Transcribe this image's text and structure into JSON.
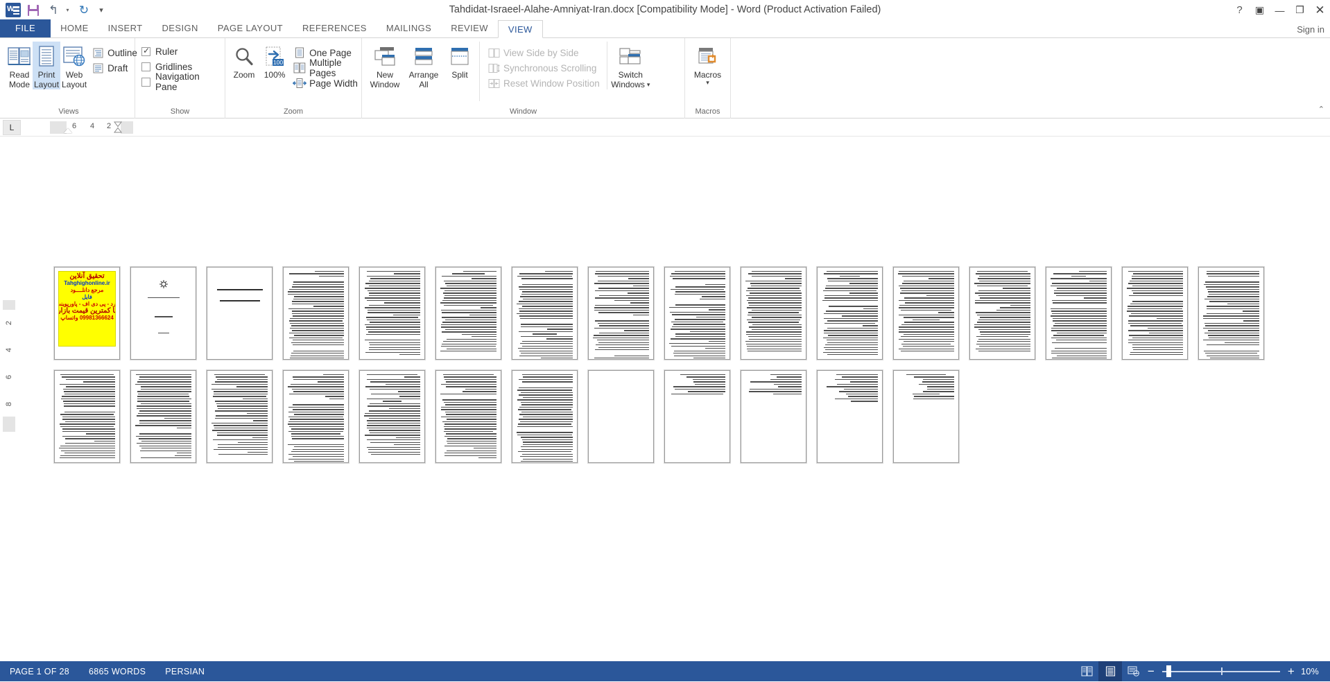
{
  "titlebar": {
    "document_title": "Tahdidat-Israeel-Alahe-Amniyat-Iran.docx [Compatibility Mode] - Word (Product Activation Failed)",
    "quick_access": [
      {
        "name": "word-logo-icon",
        "label": "W"
      },
      {
        "name": "save-icon",
        "label": ""
      },
      {
        "name": "undo-icon",
        "label": "↰"
      },
      {
        "name": "redo-icon",
        "label": "↻"
      },
      {
        "name": "customize-qat-icon",
        "label": "▾"
      }
    ],
    "window_controls": {
      "help": "?",
      "ribbon_display": "▣",
      "minimize": "—",
      "restore": "❐",
      "close": "✕"
    }
  },
  "tabs": {
    "items": [
      {
        "label": "FILE",
        "active": false,
        "file": true
      },
      {
        "label": "HOME",
        "active": false
      },
      {
        "label": "INSERT",
        "active": false
      },
      {
        "label": "DESIGN",
        "active": false
      },
      {
        "label": "PAGE LAYOUT",
        "active": false
      },
      {
        "label": "REFERENCES",
        "active": false
      },
      {
        "label": "MAILINGS",
        "active": false
      },
      {
        "label": "REVIEW",
        "active": false
      },
      {
        "label": "VIEW",
        "active": true
      }
    ],
    "sign_in": "Sign in"
  },
  "ribbon": {
    "groups": [
      {
        "name": "views",
        "label": "Views",
        "big_buttons": [
          {
            "label_line1": "Read",
            "label_line2": "Mode",
            "selected": false,
            "icon": "read-mode-icon"
          },
          {
            "label_line1": "Print",
            "label_line2": "Layout",
            "selected": true,
            "icon": "print-layout-icon"
          },
          {
            "label_line1": "Web",
            "label_line2": "Layout",
            "selected": false,
            "icon": "web-layout-icon"
          }
        ],
        "small_buttons": [
          {
            "label": "Outline",
            "icon": "outline-icon"
          },
          {
            "label": "Draft",
            "icon": "draft-icon"
          }
        ]
      },
      {
        "name": "show",
        "label": "Show",
        "checkboxes": [
          {
            "label": "Ruler",
            "checked": true
          },
          {
            "label": "Gridlines",
            "checked": false
          },
          {
            "label": "Navigation Pane",
            "checked": false
          }
        ]
      },
      {
        "name": "zoom",
        "label": "Zoom",
        "big_buttons": [
          {
            "label_line1": "Zoom",
            "label_line2": "",
            "icon": "magnifier-icon"
          },
          {
            "label_line1": "100%",
            "label_line2": "",
            "icon": "zoom-100-icon"
          }
        ],
        "small_buttons": [
          {
            "label": "One Page",
            "icon": "one-page-icon"
          },
          {
            "label": "Multiple Pages",
            "icon": "multiple-pages-icon"
          },
          {
            "label": "Page Width",
            "icon": "page-width-icon"
          }
        ]
      },
      {
        "name": "window",
        "label": "Window",
        "big_buttons": [
          {
            "label_line1": "New",
            "label_line2": "Window",
            "icon": "new-window-icon"
          },
          {
            "label_line1": "Arrange",
            "label_line2": "All",
            "icon": "arrange-all-icon"
          },
          {
            "label_line1": "Split",
            "label_line2": "",
            "icon": "split-icon"
          }
        ],
        "small_buttons": [
          {
            "label": "View Side by Side",
            "icon": "view-side-by-side-icon",
            "disabled": true
          },
          {
            "label": "Synchronous Scrolling",
            "icon": "synchronous-scrolling-icon",
            "disabled": true
          },
          {
            "label": "Reset Window Position",
            "icon": "reset-window-position-icon",
            "disabled": true
          }
        ],
        "switch_windows": {
          "label_line1": "Switch",
          "label_line2": "Windows",
          "icon": "switch-windows-icon",
          "caret": "▾"
        }
      },
      {
        "name": "macros",
        "label": "Macros",
        "big_buttons": [
          {
            "label_line1": "Macros",
            "label_line2": "",
            "icon": "macros-icon",
            "caret": "▾"
          }
        ]
      }
    ],
    "collapse_icon": "chevron-up-icon"
  },
  "ruler": {
    "tab_selector": "L",
    "horizontal_marks": [
      "6",
      "4",
      "2"
    ],
    "vertical_marks": [
      "2",
      "4",
      "6",
      "8"
    ]
  },
  "document": {
    "ad_page": {
      "lines": [
        {
          "text": "تحقیق آنلاین",
          "style": "big"
        },
        {
          "text": "Tahghighonline.ir",
          "style": "blue"
        },
        {
          "text": "مرجع دانلــــود",
          "style": "normal"
        },
        {
          "text": "فایل",
          "style": "blue"
        },
        {
          "text": "ورد - پی دی اف - پاورپوینت",
          "style": "normal"
        },
        {
          "text": "با کمترین قیمت بازار",
          "style": "big"
        },
        {
          "text": "09981366624 واتساپ",
          "style": "normal"
        }
      ]
    },
    "title_page_lines": [
      "به نام خداوند بخشنده مهربان",
      "تقدیم به",
      "خانواده"
    ],
    "title_page2_lines": [
      "نام قشنگی که با گل",
      "تزیین میگردد است"
    ],
    "page_count": 28,
    "row1_pages": 16,
    "row2_pages": 12
  },
  "status": {
    "page_indicator": "PAGE 1 OF 28",
    "word_count": "6865 WORDS",
    "language": "PERSIAN",
    "view_buttons": [
      {
        "name": "read-mode-view-button",
        "icon": "read-mode-icon",
        "active": false
      },
      {
        "name": "print-layout-view-button",
        "icon": "print-layout-icon",
        "active": true
      },
      {
        "name": "web-layout-view-button",
        "icon": "web-layout-icon",
        "active": false
      }
    ],
    "zoom_out": "−",
    "zoom_in": "+",
    "zoom_level": "10%"
  },
  "colors": {
    "accent": "#2b579a",
    "ribbon_selected": "#cde0f5",
    "status_bar": "#2b579a",
    "ad_background": "#ffff00",
    "ad_text_red": "#cc0000",
    "ad_text_blue": "#0033cc"
  }
}
